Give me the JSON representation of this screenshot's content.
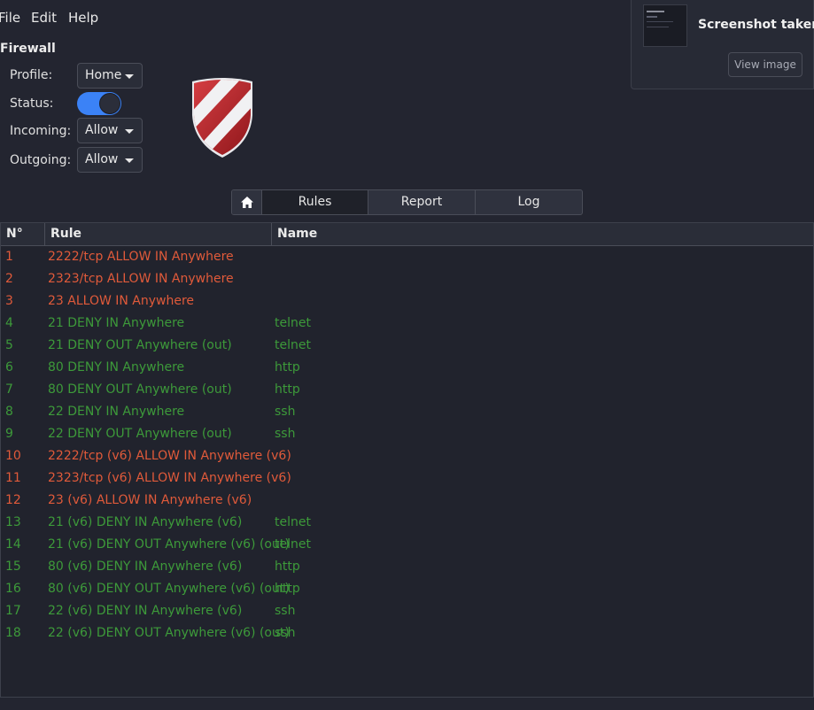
{
  "menu": [
    "File",
    "Edit",
    "Help"
  ],
  "section_title": "Firewall",
  "profile": {
    "label": "Profile:",
    "value": "Home"
  },
  "status": {
    "label": "Status:",
    "enabled": true
  },
  "incoming": {
    "label": "Incoming:",
    "value": "Allow"
  },
  "outgoing": {
    "label": "Outgoing:",
    "value": "Allow"
  },
  "notification": {
    "title": "Screenshot taken",
    "button": "View image"
  },
  "tabs": {
    "home_icon": "home-icon",
    "rules": "Rules",
    "report": "Report",
    "log": "Log"
  },
  "table": {
    "headers": [
      "N°",
      "Rule",
      "Name"
    ],
    "rows": [
      {
        "n": "1",
        "rule": "2222/tcp ALLOW IN Anywhere",
        "name": "",
        "action": "allow"
      },
      {
        "n": "2",
        "rule": "2323/tcp ALLOW IN Anywhere",
        "name": "",
        "action": "allow"
      },
      {
        "n": "3",
        "rule": "23 ALLOW IN Anywhere",
        "name": "",
        "action": "allow"
      },
      {
        "n": "4",
        "rule": "21 DENY IN Anywhere",
        "name": "telnet",
        "action": "deny"
      },
      {
        "n": "5",
        "rule": "21 DENY OUT Anywhere (out)",
        "name": "telnet",
        "action": "deny"
      },
      {
        "n": "6",
        "rule": "80 DENY IN Anywhere",
        "name": "http",
        "action": "deny"
      },
      {
        "n": "7",
        "rule": "80 DENY OUT Anywhere (out)",
        "name": "http",
        "action": "deny"
      },
      {
        "n": "8",
        "rule": "22 DENY IN Anywhere",
        "name": "ssh",
        "action": "deny"
      },
      {
        "n": "9",
        "rule": "22 DENY OUT Anywhere (out)",
        "name": "ssh",
        "action": "deny"
      },
      {
        "n": "10",
        "rule": "2222/tcp (v6) ALLOW IN Anywhere (v6)",
        "name": "",
        "action": "allow"
      },
      {
        "n": "11",
        "rule": "2323/tcp (v6) ALLOW IN Anywhere (v6)",
        "name": "",
        "action": "allow"
      },
      {
        "n": "12",
        "rule": "23 (v6) ALLOW IN Anywhere (v6)",
        "name": "",
        "action": "allow"
      },
      {
        "n": "13",
        "rule": "21 (v6) DENY IN Anywhere (v6)",
        "name": "telnet",
        "action": "deny"
      },
      {
        "n": "14",
        "rule": "21 (v6) DENY OUT Anywhere (v6) (out)",
        "name": "telnet",
        "action": "deny"
      },
      {
        "n": "15",
        "rule": "80 (v6) DENY IN Anywhere (v6)",
        "name": "http",
        "action": "deny"
      },
      {
        "n": "16",
        "rule": "80 (v6) DENY OUT Anywhere (v6) (out)",
        "name": "http",
        "action": "deny"
      },
      {
        "n": "17",
        "rule": "22 (v6) DENY IN Anywhere (v6)",
        "name": "ssh",
        "action": "deny"
      },
      {
        "n": "18",
        "rule": "22 (v6) DENY OUT Anywhere (v6) (out)",
        "name": "ssh",
        "action": "deny"
      }
    ]
  },
  "colors": {
    "allow": "#e05a3a",
    "deny": "#3d9a3a",
    "accent": "#3b82f6",
    "background": "#232530"
  }
}
